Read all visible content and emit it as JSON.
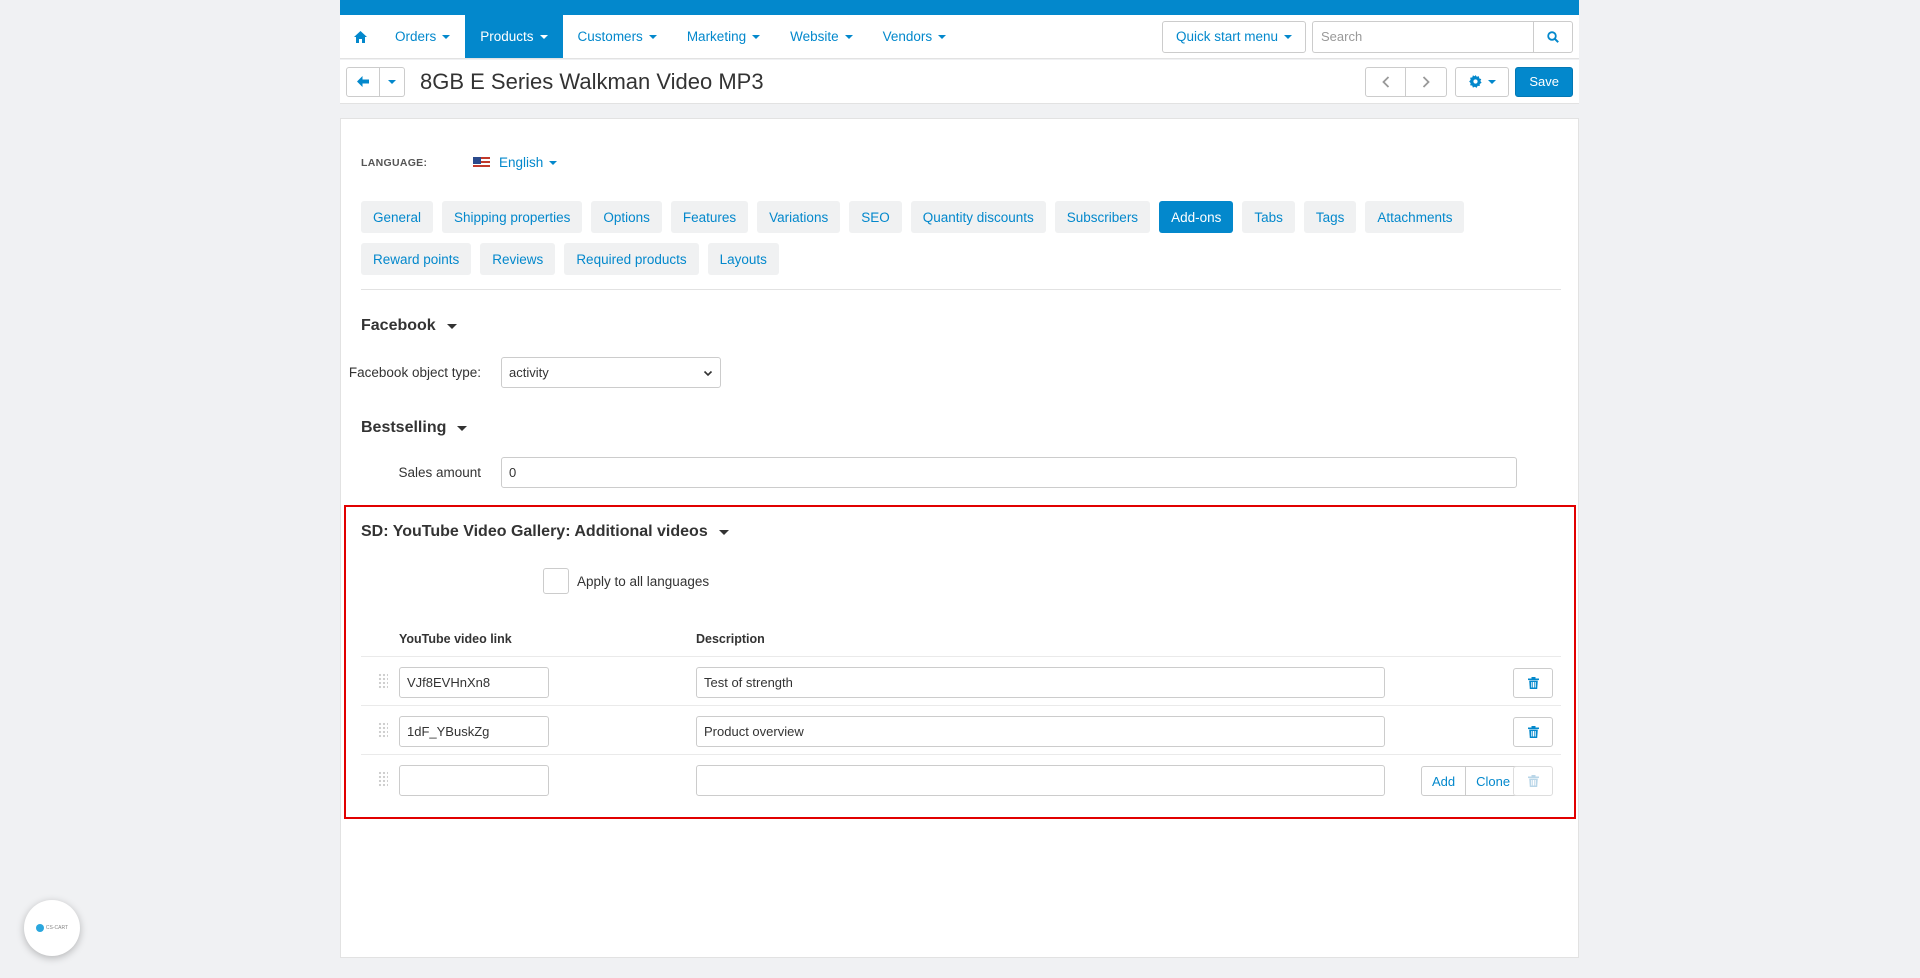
{
  "nav": {
    "items": [
      {
        "label": "Orders",
        "active": false
      },
      {
        "label": "Products",
        "active": true
      },
      {
        "label": "Customers",
        "active": false
      },
      {
        "label": "Marketing",
        "active": false
      },
      {
        "label": "Website",
        "active": false
      },
      {
        "label": "Vendors",
        "active": false
      }
    ],
    "quick_start": "Quick start menu",
    "search_placeholder": "Search"
  },
  "title_bar": {
    "title": "8GB E Series Walkman Video MP3",
    "save_label": "Save"
  },
  "language": {
    "label": "LANGUAGE:",
    "value": "English"
  },
  "tabs": [
    {
      "label": "General",
      "active": false
    },
    {
      "label": "Shipping properties",
      "active": false
    },
    {
      "label": "Options",
      "active": false
    },
    {
      "label": "Features",
      "active": false
    },
    {
      "label": "Variations",
      "active": false
    },
    {
      "label": "SEO",
      "active": false
    },
    {
      "label": "Quantity discounts",
      "active": false
    },
    {
      "label": "Subscribers",
      "active": false
    },
    {
      "label": "Add-ons",
      "active": true
    },
    {
      "label": "Tabs",
      "active": false
    },
    {
      "label": "Tags",
      "active": false
    },
    {
      "label": "Attachments",
      "active": false
    },
    {
      "label": "Reward points",
      "active": false
    },
    {
      "label": "Reviews",
      "active": false
    },
    {
      "label": "Required products",
      "active": false
    },
    {
      "label": "Layouts",
      "active": false
    }
  ],
  "facebook": {
    "title": "Facebook",
    "object_type_label": "Facebook object type:",
    "object_type_value": "activity"
  },
  "bestselling": {
    "title": "Bestselling",
    "sales_label": "Sales amount",
    "sales_value": "0"
  },
  "youtube": {
    "title": "SD: YouTube Video Gallery: Additional videos",
    "apply_all_label": "Apply to all languages",
    "col_link": "YouTube video link",
    "col_desc": "Description",
    "rows": [
      {
        "link": "VJf8EVHnXn8",
        "desc": "Test of strength"
      },
      {
        "link": "1dF_YBuskZg",
        "desc": "Product overview"
      },
      {
        "link": "",
        "desc": ""
      }
    ],
    "add_label": "Add",
    "clone_label": "Clone"
  },
  "help": {
    "text": "CS-CART"
  },
  "colors": {
    "accent": "#0388cc",
    "highlight_border": "#e10000"
  }
}
